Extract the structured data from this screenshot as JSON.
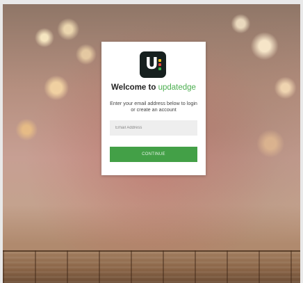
{
  "brand": {
    "logo_letter": "U",
    "dot_colors": [
      "#f3c21b",
      "#e8423b",
      "#35b24a"
    ]
  },
  "login": {
    "title_prefix": "Welcome to ",
    "title_brand": "updatedge",
    "subtitle": "Enter your email address below to login or create an account",
    "email_placeholder": "Email Address",
    "email_value": "",
    "continue_label": "CONTINUE"
  },
  "colors": {
    "accent": "#43a047",
    "brand_text": "#4caf50",
    "logo_bg": "#17201f"
  }
}
